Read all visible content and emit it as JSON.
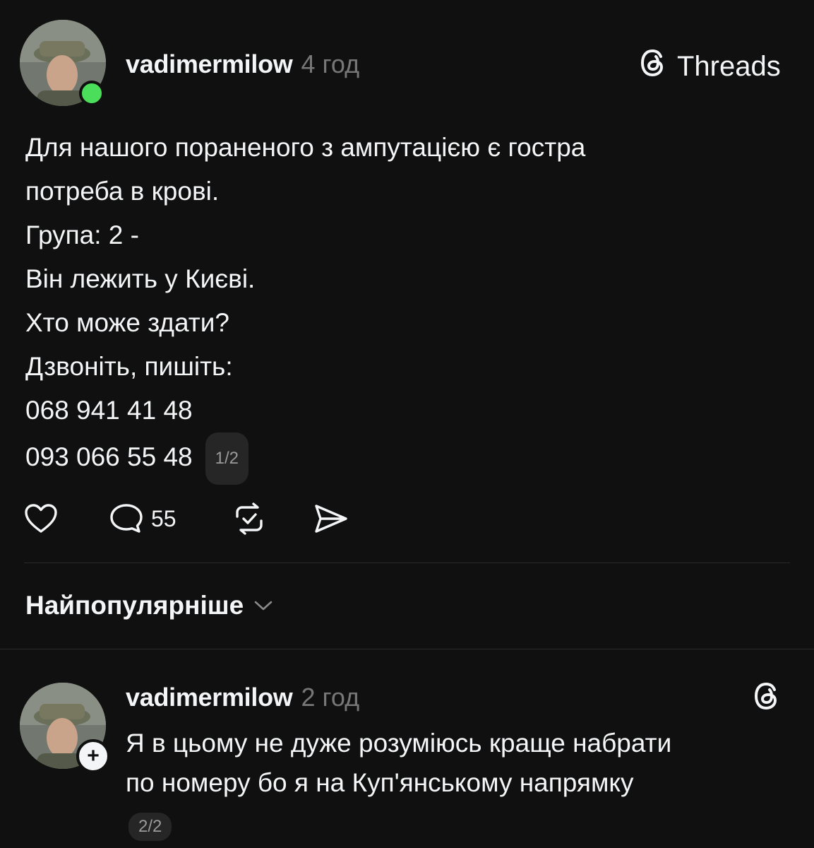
{
  "brand": {
    "name": "Threads",
    "icon": "threads-logo-icon"
  },
  "post": {
    "username": "vadimermilow",
    "time": "4 год",
    "lines": [
      "Для нашого пораненого з ампутацією є гостра",
      "потреба в крові.",
      "Група: 2 -",
      "Він лежить у Києві.",
      "Хто може здати?",
      "Дзвоніть, пишіть:",
      "068 941 41 48",
      "093 066 55 48"
    ],
    "thread_counter": "1/2",
    "actions": {
      "like_icon": "heart-icon",
      "comment_icon": "comment-icon",
      "comment_count": "55",
      "repost_icon": "repost-icon",
      "share_icon": "share-icon"
    },
    "online_status_color": "#4ade5b"
  },
  "sort": {
    "label": "Найпопулярніше",
    "icon": "chevron-down-icon"
  },
  "reply": {
    "username": "vadimermilow",
    "time": "2 год",
    "lines": [
      "Я в цьому не дуже розуміюсь краще набрати",
      "по номеру бо я на Куп'янському напрямку"
    ],
    "thread_counter": "2/2",
    "follow_icon": "plus-icon",
    "threads_icon": "threads-logo-icon"
  }
}
